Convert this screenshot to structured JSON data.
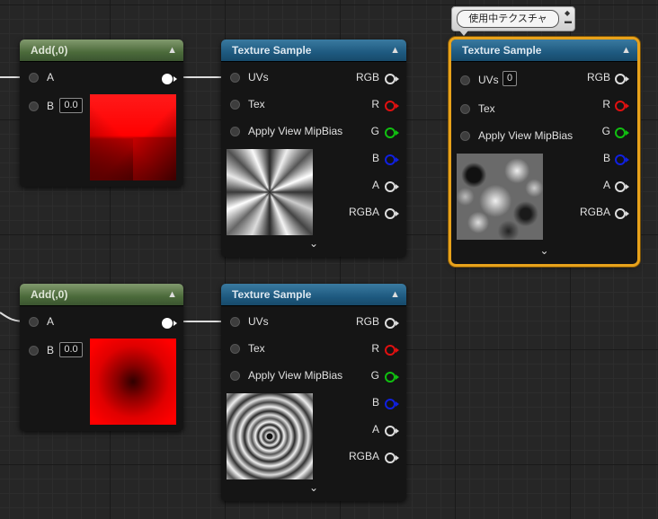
{
  "tooltip": {
    "text": "使用中テクスチャ",
    "pin_icon": "pin-icon"
  },
  "add_nodes": [
    {
      "title": "Add(,0)",
      "pin_a": "A",
      "pin_b": "B",
      "b_value": "0.0"
    },
    {
      "title": "Add(,0)",
      "pin_a": "A",
      "pin_b": "B",
      "b_value": "0.0"
    }
  ],
  "texture_nodes": [
    {
      "title": "Texture Sample",
      "inputs": [
        "UVs",
        "Tex",
        "Apply View MipBias"
      ],
      "outputs": [
        "RGB",
        "R",
        "G",
        "B",
        "A",
        "RGBA"
      ]
    },
    {
      "title": "Texture Sample",
      "uv_value": "0",
      "inputs": [
        "UVs",
        "Tex",
        "Apply View MipBias"
      ],
      "outputs": [
        "RGB",
        "R",
        "G",
        "B",
        "A",
        "RGBA"
      ]
    },
    {
      "title": "Texture Sample",
      "inputs": [
        "UVs",
        "Tex",
        "Apply View MipBias"
      ],
      "outputs": [
        "RGB",
        "R",
        "G",
        "B",
        "A",
        "RGBA"
      ]
    }
  ],
  "colors": {
    "selection": "#e8a21b",
    "pin_r": "#e01010",
    "pin_g": "#10c010",
    "pin_b": "#1020e0",
    "header_add": "#4b6a3a",
    "header_texture": "#1e5a80",
    "wire": "#ffffff"
  },
  "icons": {
    "collapse": "▲",
    "expand": "⌄"
  }
}
